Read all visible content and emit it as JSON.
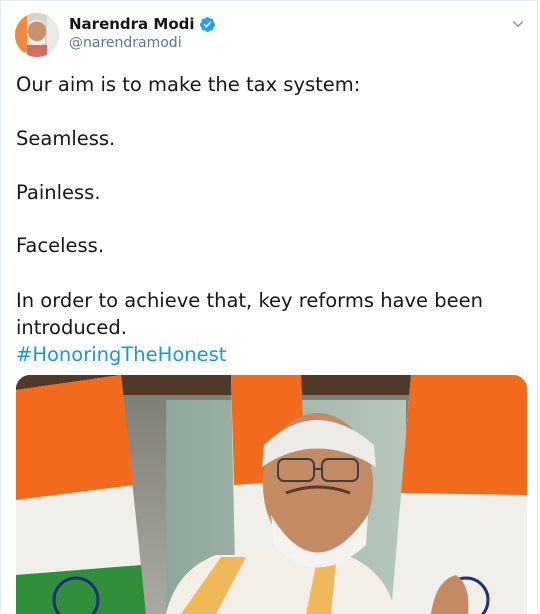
{
  "tweet": {
    "author_name": "Narendra Modi",
    "author_handle": "@narendramodi",
    "verified": true,
    "lines": [
      "Our aim is to make the tax system:",
      "Seamless.",
      "Painless.",
      "Faceless.",
      "In order to achieve that, key reforms have been",
      "introduced."
    ],
    "hashtag": "#HonoringTheHonest"
  },
  "icons": {
    "verified": "verified-badge-icon",
    "caret": "chevron-down-icon"
  },
  "colors": {
    "link": "#1b95e0",
    "verified": "#1da1f2",
    "handle": "#657786",
    "saffron": "#f26b1d",
    "flag_green": "#2f8f3a"
  }
}
